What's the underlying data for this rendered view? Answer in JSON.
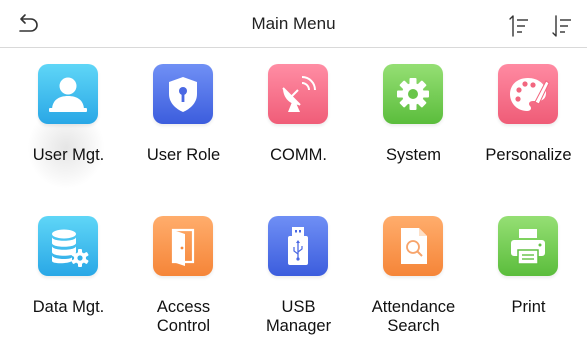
{
  "header": {
    "title": "Main Menu"
  },
  "colors": {
    "blue_grad": [
      "#59d0f5",
      "#2aa8e6"
    ],
    "navy_grad": [
      "#6a86f2",
      "#3e5fe0"
    ],
    "pink_grad": [
      "#ff8aa2",
      "#f2607a"
    ],
    "green_grad": [
      "#8fdc6f",
      "#5ebf3f"
    ],
    "orange_grad": [
      "#ffab6a",
      "#f6873a"
    ]
  },
  "menu": {
    "items": [
      {
        "label": "User Mgt.",
        "icon": "user-icon"
      },
      {
        "label": "User Role",
        "icon": "shield-key-icon"
      },
      {
        "label": "COMM.",
        "icon": "satellite-dish-icon"
      },
      {
        "label": "System",
        "icon": "gear-icon"
      },
      {
        "label": "Personalize",
        "icon": "palette-icon"
      },
      {
        "label": "Data Mgt.",
        "icon": "database-gear-icon"
      },
      {
        "label": "Access\nControl",
        "icon": "door-icon"
      },
      {
        "label": "USB\nManager",
        "icon": "usb-drive-icon"
      },
      {
        "label": "Attendance\nSearch",
        "icon": "document-search-icon"
      },
      {
        "label": "Print",
        "icon": "printer-icon"
      }
    ]
  }
}
